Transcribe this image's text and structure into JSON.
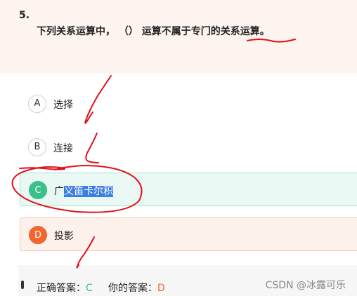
{
  "question": {
    "number": "5.",
    "text_before": "下列关系运算中，",
    "blank": "（）",
    "text_after": "运算不属于专门的关系运算。"
  },
  "options": [
    {
      "letter": "A",
      "label": "选择"
    },
    {
      "letter": "B",
      "label": "连接"
    },
    {
      "letter": "C",
      "label_plain": "广",
      "label_selected": "义笛卡尔积"
    },
    {
      "letter": "D",
      "label": "投影"
    }
  ],
  "answer": {
    "correct_label": "正确答案：",
    "correct_value": "C",
    "mine_label": "你的答案：",
    "mine_value": "D"
  },
  "watermark": "CSDN @冰露可乐",
  "colors": {
    "header_bg": "#fdf3ef",
    "correct": "#3bc08c",
    "wrong": "#f4652e",
    "ink": "#e0101a",
    "selection": "#3d7ee1"
  }
}
